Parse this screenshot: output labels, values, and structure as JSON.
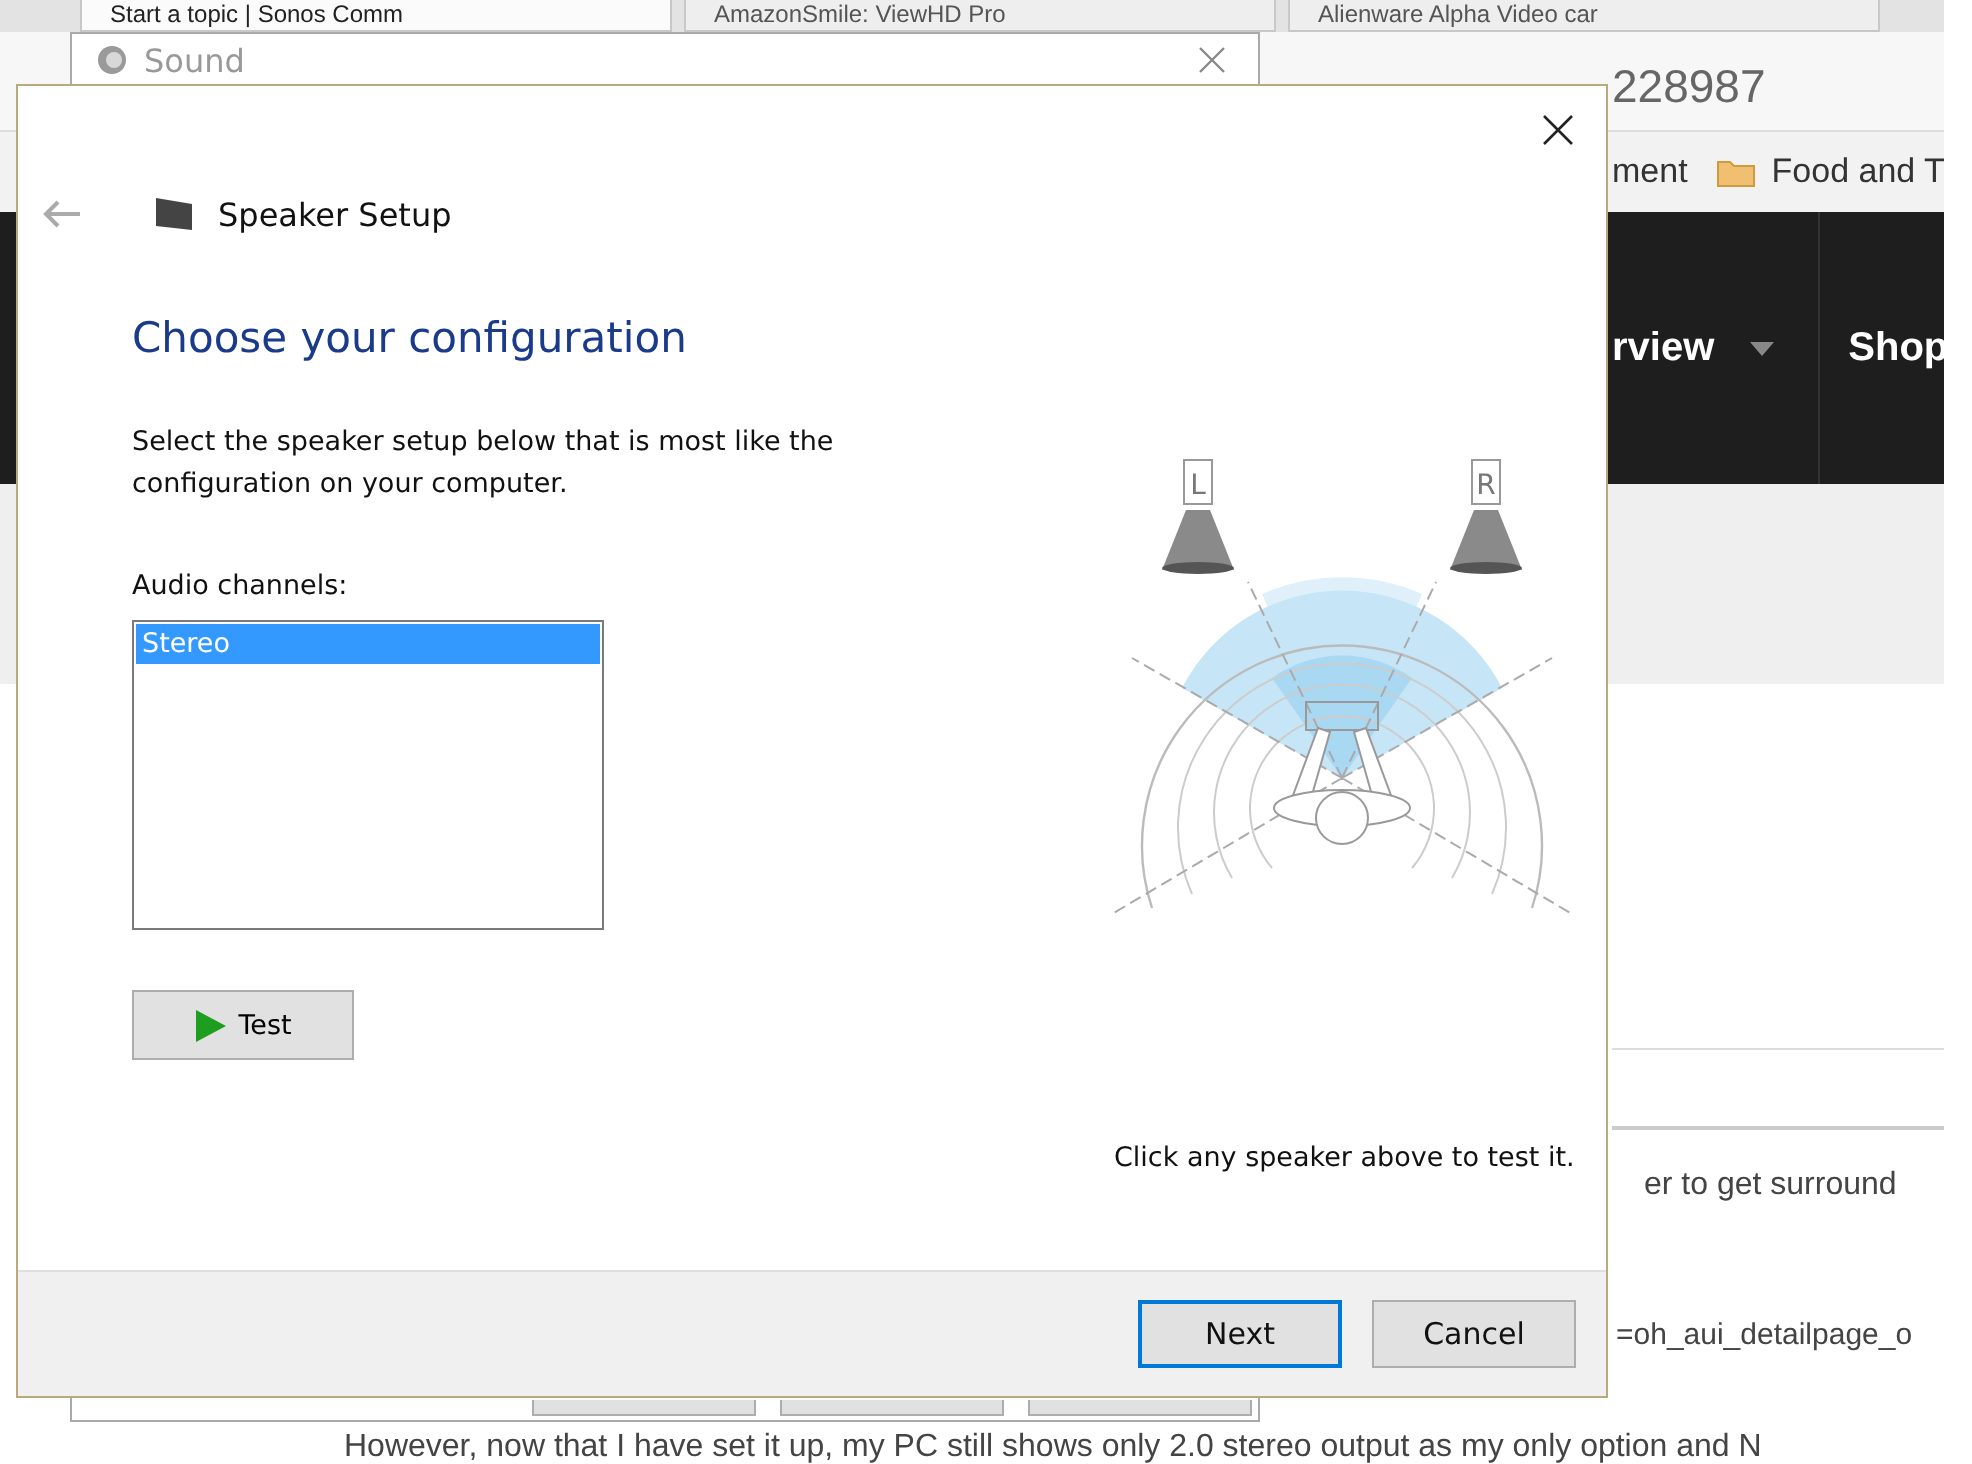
{
  "browser": {
    "tabs": [
      {
        "title": "Start a topic | Sonos Comm",
        "selected": true
      },
      {
        "title": "AmazonSmile: ViewHD Pro",
        "selected": false
      },
      {
        "title": "Alienware Alpha Video car",
        "selected": false
      }
    ],
    "address": "228987",
    "bookmarks": [
      {
        "label": "ment",
        "kind": "plain"
      },
      {
        "label": "Food and T",
        "kind": "folder"
      }
    ],
    "nav": [
      {
        "label": "rview",
        "dropdown": true
      },
      {
        "label": "Shop",
        "dropdown": false
      }
    ],
    "content_lines": [
      "er to get surround",
      "=oh_aui_detailpage_o",
      "However, now that I have set it up, my PC still shows only 2.0 stereo output as my only option and N"
    ]
  },
  "sound_window": {
    "title": "Sound"
  },
  "wizard": {
    "title": "Speaker Setup",
    "heading": "Choose your configuration",
    "description": "Select the speaker setup below that is most like the configuration on your computer.",
    "list_label": "Audio channels:",
    "channels": [
      {
        "label": "Stereo",
        "selected": true
      }
    ],
    "test_button": "Test",
    "speakers": [
      {
        "label": "L"
      },
      {
        "label": "R"
      }
    ],
    "hint": "Click any speaker above to test it.",
    "buttons": [
      {
        "label": "Next",
        "default": true
      },
      {
        "label": "Cancel",
        "default": false
      }
    ]
  }
}
